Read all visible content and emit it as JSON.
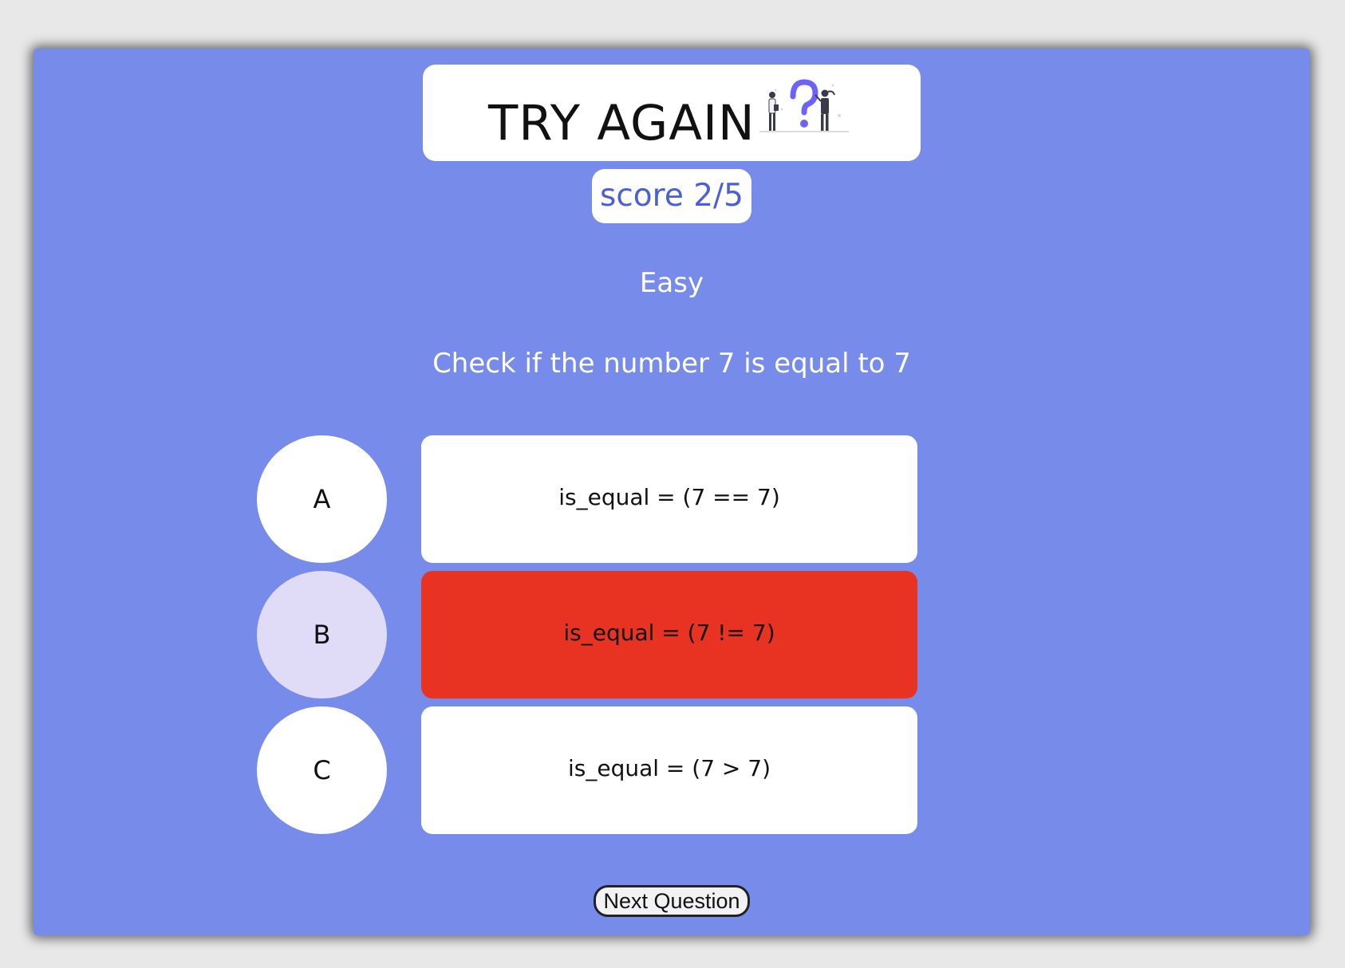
{
  "header": {
    "title": "TRY AGAIN",
    "illustration_icon": "question-mark-people-illustration"
  },
  "score": {
    "label": "score 2/5"
  },
  "quiz": {
    "difficulty": "Easy",
    "question": "Check if the number 7 is equal to 7",
    "options": [
      {
        "letter": "A",
        "answer": "is_equal = (7 == 7)",
        "state": "default"
      },
      {
        "letter": "B",
        "answer": "is_equal = (7 != 7)",
        "state": "wrong-selected"
      },
      {
        "letter": "C",
        "answer": "is_equal = (7 > 7)",
        "state": "default"
      }
    ]
  },
  "footer": {
    "next_label": "Next Question"
  },
  "colors": {
    "background": "#778beb",
    "wrong": "#e83322",
    "selected_letter": "#e0dcf7",
    "accent_text": "#4b5fd6"
  }
}
